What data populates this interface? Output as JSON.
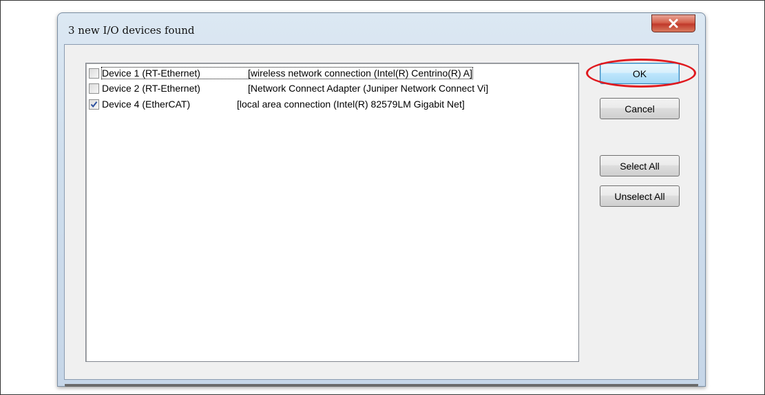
{
  "dialog": {
    "title": "3 new I/O devices found"
  },
  "devices": [
    {
      "name": "Device 1 (RT-Ethernet)",
      "description": "[wireless network connection (Intel(R) Centrino(R) A]",
      "checked": false
    },
    {
      "name": "Device 2 (RT-Ethernet)",
      "description": "[Network Connect Adapter (Juniper Network Connect Vi]",
      "checked": false
    },
    {
      "name": "Device 4 (EtherCAT)",
      "description": "[local area connection (Intel(R) 82579LM Gigabit Net]",
      "checked": true
    }
  ],
  "buttons": {
    "ok": "OK",
    "cancel": "Cancel",
    "select_all": "Select All",
    "unselect_all": "Unselect All"
  },
  "colors": {
    "annotation_ring": "#e0191e",
    "close_button": "#c0392b",
    "default_button_border": "#3c7fb1"
  }
}
